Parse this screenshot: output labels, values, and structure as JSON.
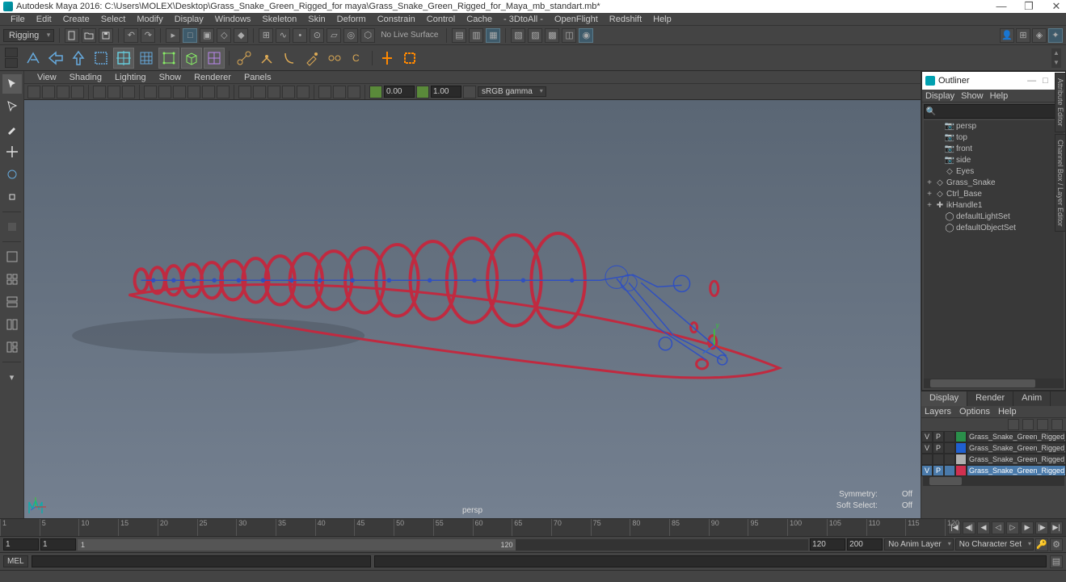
{
  "window": {
    "title": "Autodesk Maya 2016: C:\\Users\\MOLEX\\Desktop\\Grass_Snake_Green_Rigged_for maya\\Grass_Snake_Green_Rigged_for_Maya_mb_standart.mb*"
  },
  "menubar": [
    "File",
    "Edit",
    "Create",
    "Select",
    "Modify",
    "Display",
    "Windows",
    "Skeleton",
    "Skin",
    "Deform",
    "Constrain",
    "Control",
    "Cache",
    "- 3DtoAll -",
    "OpenFlight",
    "Redshift",
    "Help"
  ],
  "toolbar": {
    "mode_dropdown": "Rigging",
    "snap_label": "No Live Surface"
  },
  "panelmenu": [
    "View",
    "Shading",
    "Lighting",
    "Show",
    "Renderer",
    "Panels"
  ],
  "paneltoolbar": {
    "near": "0.00",
    "far": "1.00",
    "colorspace": "sRGB gamma"
  },
  "viewport": {
    "camera": "persp",
    "symmetry_label": "Symmetry:",
    "symmetry_value": "Off",
    "softselect_label": "Soft Select:",
    "softselect_value": "Off"
  },
  "outliner": {
    "title": "Outliner",
    "menu": [
      "Display",
      "Show",
      "Help"
    ],
    "items": [
      {
        "icon": "camera",
        "label": "persp",
        "exp": ""
      },
      {
        "icon": "camera",
        "label": "top",
        "exp": ""
      },
      {
        "icon": "camera",
        "label": "front",
        "exp": ""
      },
      {
        "icon": "camera",
        "label": "side",
        "exp": ""
      },
      {
        "icon": "group",
        "label": "Eyes",
        "exp": ""
      },
      {
        "icon": "group",
        "label": "Grass_Snake",
        "exp": "+"
      },
      {
        "icon": "group",
        "label": "Ctrl_Base",
        "exp": "+"
      },
      {
        "icon": "ik",
        "label": "ikHandle1",
        "exp": "+"
      },
      {
        "icon": "set",
        "label": "defaultLightSet",
        "exp": ""
      },
      {
        "icon": "set",
        "label": "defaultObjectSet",
        "exp": ""
      }
    ]
  },
  "layereditor": {
    "tabs": [
      "Display",
      "Render",
      "Anim"
    ],
    "active_tab": "Display",
    "menu": [
      "Layers",
      "Options",
      "Help"
    ],
    "rows": [
      {
        "vis": "V",
        "p": "P",
        "color": "#2a8f4a",
        "name": "Grass_Snake_Green_Rigged_help",
        "sel": false
      },
      {
        "vis": "V",
        "p": "P",
        "color": "#2060d0",
        "name": "Grass_Snake_Green_Rigged_bon",
        "sel": false
      },
      {
        "vis": "",
        "p": "",
        "color": "#b0b0b0",
        "name": "Grass_Snake_Green_Rigged_Rig",
        "sel": false
      },
      {
        "vis": "V",
        "p": "P",
        "color": "#d03050",
        "name": "Grass_Snake_Green_Rigged_con",
        "sel": true
      }
    ]
  },
  "timeline": {
    "ticks": [
      1,
      5,
      10,
      15,
      20,
      25,
      30,
      35,
      40,
      45,
      50,
      55,
      60,
      65,
      70,
      75,
      80,
      85,
      90,
      95,
      100,
      105,
      110,
      115,
      120
    ]
  },
  "range": {
    "start_outer": "1",
    "start_inner": "1",
    "slider_start": "1",
    "slider_end": "120",
    "end_inner": "120",
    "end_outer": "200",
    "anim_layer": "No Anim Layer",
    "char_set": "No Character Set"
  },
  "cmdline": {
    "lang": "MEL"
  },
  "vert_tabs": [
    "Attribute Editor",
    "Channel Box / Layer Editor"
  ],
  "colors": {
    "rig_red": "#c02a40",
    "joint_blue": "#3050c0"
  }
}
